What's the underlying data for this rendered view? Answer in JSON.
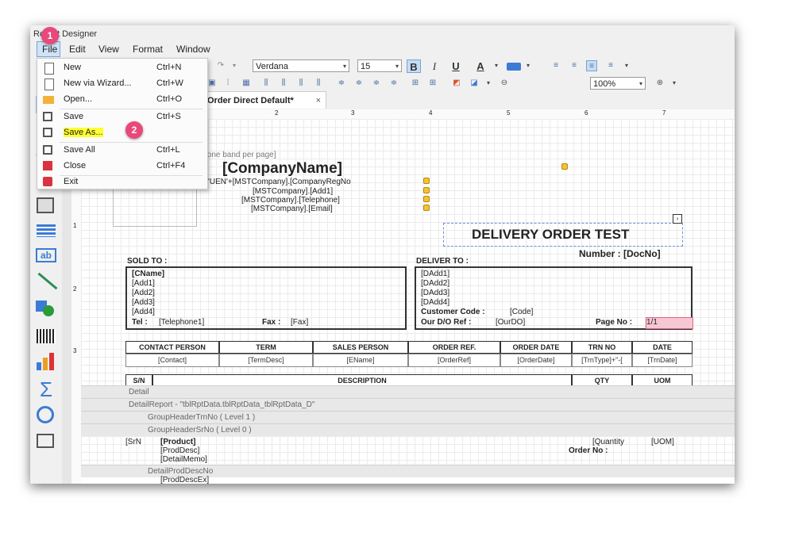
{
  "window": {
    "title": "Report Designer"
  },
  "menubar": {
    "items": [
      "File",
      "Edit",
      "View",
      "Format",
      "Window"
    ]
  },
  "toolbar": {
    "font_name": "Verdana",
    "font_size": "15",
    "zoom": "100%",
    "bold": "B",
    "italic": "I",
    "underline": "U",
    "font_color": "A"
  },
  "tab": {
    "label": "Order Direct Default*",
    "close": "×"
  },
  "file_menu": [
    {
      "label": "New",
      "shortcut": "Ctrl+N",
      "icon": "new-file-icon"
    },
    {
      "label": "New via Wizard...",
      "shortcut": "Ctrl+W",
      "icon": "wizard-icon"
    },
    {
      "label": "Open...",
      "shortcut": "Ctrl+O",
      "icon": "folder-open-icon"
    },
    {
      "label": "Save",
      "shortcut": "Ctrl+S",
      "icon": "save-icon"
    },
    {
      "label": "Save As...",
      "shortcut": "",
      "icon": "save-as-icon",
      "highlighted": true
    },
    {
      "label": "Save All",
      "shortcut": "Ctrl+L",
      "icon": "save-all-icon"
    },
    {
      "label": "Close",
      "shortcut": "Ctrl+F4",
      "icon": "close-doc-icon"
    },
    {
      "label": "Exit",
      "shortcut": "",
      "icon": "exit-icon"
    }
  ],
  "badges": {
    "b1": "1",
    "b2": "2"
  },
  "ruler": {
    "marks": [
      "2",
      "3",
      "4",
      "5",
      "6",
      "7"
    ],
    "v_marks": [
      "1",
      "2",
      "3"
    ]
  },
  "report": {
    "band_hint": "[one band per page]",
    "company": "[CompanyName]",
    "reg": "'UEN'+[MSTCompany].[CompanyRegNo",
    "add1": "[MSTCompany].[Add1]",
    "tel": "[MSTCompany].[Telephone]",
    "email": "[MSTCompany].[Email]",
    "doc_title": "DELIVERY ORDER TEST",
    "doc_no": "Number : [DocNo]",
    "sold_to": "SOLD TO :",
    "deliver_to": "DELIVER TO :",
    "sold": [
      "[CName]",
      "[Add1]",
      "[Add2]",
      "[Add3]",
      "[Add4]"
    ],
    "tel_label": "Tel :",
    "tel_val": "[Telephone1]",
    "fax_label": "Fax :",
    "fax_val": "[Fax]",
    "deliver": [
      "[DAdd1]",
      "[DAdd2]",
      "[DAdd3]",
      "[DAdd4]"
    ],
    "cust_code_label": "Customer Code :",
    "cust_code_val": "[Code]",
    "our_ref_label": "Our D/O Ref :",
    "our_ref_val": "[OurDO]",
    "page_label": "Page No :",
    "page_val": "1/1",
    "table_headers": [
      "CONTACT PERSON",
      "TERM",
      "SALES PERSON",
      "ORDER REF.",
      "ORDER DATE",
      "TRN NO",
      "DATE"
    ],
    "table_values": [
      "[Contact]",
      "[TermDesc]",
      "[EName]",
      "[OrderRef]",
      "[OrderDate]",
      "[TrnType]+\"-[",
      "[TrnDate]"
    ],
    "line_headers": [
      "S/N",
      "DESCRIPTION",
      "QTY",
      "UOM"
    ],
    "bands": [
      "Detail",
      "DetailReport - \"tblRptData.tblRptData_tblRptData_D\"",
      "GroupHeaderTrnNo ( Level 1 )",
      "GroupHeaderSrNo ( Level 0 )",
      "DetailProdDescNo"
    ],
    "detail": {
      "srno": "[SrN",
      "product": "[Product]",
      "proddesc": "[ProdDesc]",
      "memo": "[DetailMemo]",
      "qty": "[Quantity",
      "uom": "[UOM]",
      "order_no": "Order No :",
      "prodex": "[ProdDescEx]"
    }
  }
}
